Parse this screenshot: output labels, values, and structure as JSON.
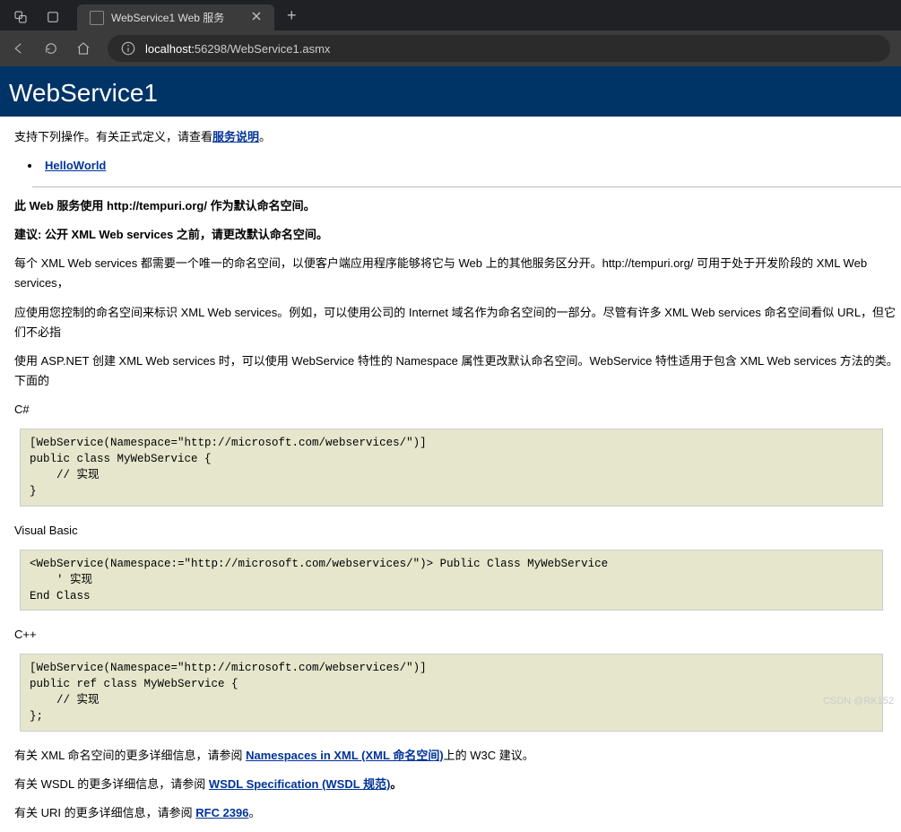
{
  "browser": {
    "tab_title": "WebService1 Web 服务",
    "url_host": "localhost:",
    "url_path": "56298/WebService1.asmx",
    "new_tab": "+"
  },
  "page": {
    "title": "WebService1",
    "intro_prefix": "支持下列操作。有关正式定义，请查看",
    "service_desc_link": "服务说明",
    "intro_suffix": "。",
    "operations": [
      "HelloWorld"
    ],
    "ns_line": "此 Web 服务使用 http://tempuri.org/ 作为默认命名空间。",
    "advice_line": "建议: 公开 XML Web services 之前，请更改默认命名空间。",
    "para1": "每个 XML Web services 都需要一个唯一的命名空间，以便客户端应用程序能够将它与 Web 上的其他服务区分开。http://tempuri.org/ 可用于处于开发阶段的 XML Web services，",
    "para2": "应使用您控制的命名空间来标识 XML Web services。例如，可以使用公司的 Internet 域名作为命名空间的一部分。尽管有许多 XML Web services 命名空间看似 URL，但它们不必指",
    "para3": "使用 ASP.NET 创建 XML Web services 时，可以使用 WebService 特性的 Namespace 属性更改默认命名空间。WebService 特性适用于包含 XML Web services 方法的类。下面的",
    "lang_csharp": "C#",
    "code_csharp": "[WebService(Namespace=\"http://microsoft.com/webservices/\")]\npublic class MyWebService {\n    // 实现\n}",
    "lang_vb": "Visual Basic",
    "code_vb": "<WebService(Namespace:=\"http://microsoft.com/webservices/\")> Public Class MyWebService\n    ' 实现\nEnd Class",
    "lang_cpp": "C++",
    "code_cpp": "[WebService(Namespace=\"http://microsoft.com/webservices/\")]\npublic ref class MyWebService {\n    // 实现\n};",
    "xml_prefix": "有关 XML 命名空间的更多详细信息，请参阅 ",
    "xml_link": "Namespaces in XML (XML 命名空间)",
    "xml_suffix": "上的 W3C 建议。",
    "wsdl_prefix": "有关 WSDL 的更多详细信息，请参阅 ",
    "wsdl_link": "WSDL Specification (WSDL 规范)",
    "wsdl_suffix": "。",
    "uri_prefix": "有关 URI 的更多详细信息，请参阅 ",
    "uri_link": "RFC 2396",
    "uri_suffix": "。"
  },
  "watermark": "CSDN @RK152"
}
